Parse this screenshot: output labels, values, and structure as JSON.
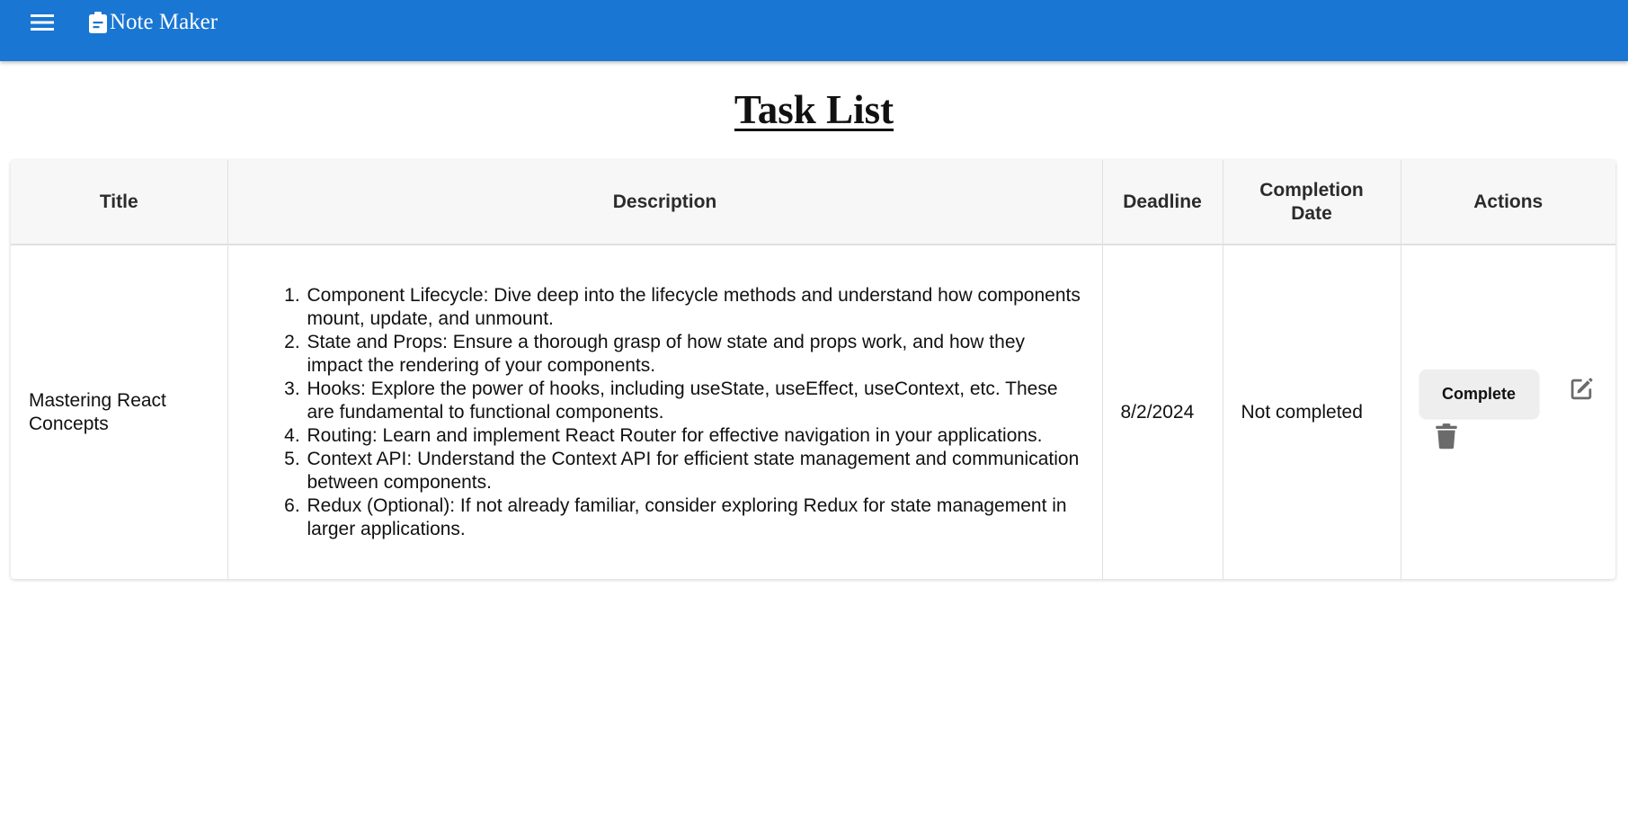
{
  "appbar": {
    "menu_icon": "menu-icon",
    "brand_icon": "clipboard-icon",
    "title": "Note Maker",
    "background_color": "#1976d2"
  },
  "page": {
    "title": "Task List"
  },
  "table": {
    "headers": {
      "title": "Title",
      "description": "Description",
      "deadline": "Deadline",
      "completion_date": "Completion Date",
      "actions": "Actions"
    },
    "rows": [
      {
        "title": "Mastering React Concepts",
        "description": [
          "Component Lifecycle: Dive deep into the lifecycle methods and understand how components mount, update, and unmount.",
          "State and Props: Ensure a thorough grasp of how state and props work, and how they impact the rendering of your components.",
          "Hooks: Explore the power of hooks, including useState, useEffect, useContext, etc. These are fundamental to functional components.",
          "Routing: Learn and implement React Router for effective navigation in your applications.",
          "Context API: Understand the Context API for efficient state management and communication between components.",
          "Redux (Optional): If not already familiar, consider exploring Redux for state management in larger applications."
        ],
        "deadline": "8/2/2024",
        "completion_date": "Not completed",
        "actions": {
          "complete_label": "Complete",
          "edit_icon": "edit-icon",
          "delete_icon": "trash-icon"
        }
      }
    ]
  }
}
